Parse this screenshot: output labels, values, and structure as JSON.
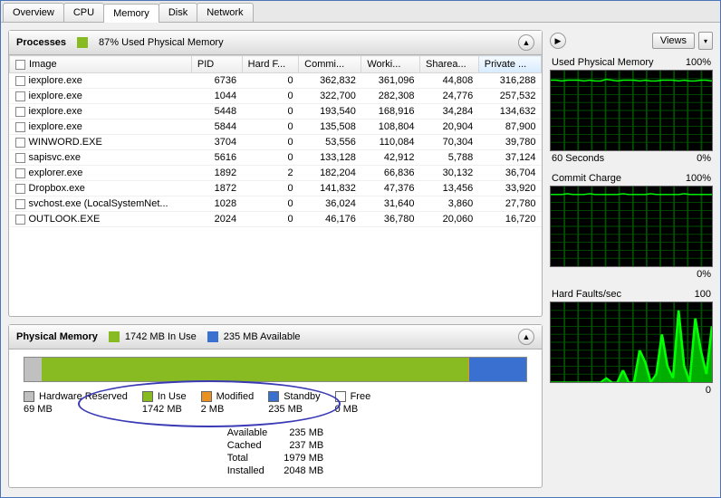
{
  "tabs": [
    "Overview",
    "CPU",
    "Memory",
    "Disk",
    "Network"
  ],
  "active_tab": "Memory",
  "processes": {
    "title": "Processes",
    "metric": "87% Used Physical Memory",
    "columns": [
      "Image",
      "PID",
      "Hard F...",
      "Commi...",
      "Worki...",
      "Sharea...",
      "Private ..."
    ],
    "sorted_col": 6,
    "rows": [
      [
        "iexplore.exe",
        "6736",
        "0",
        "362,832",
        "361,096",
        "44,808",
        "316,288"
      ],
      [
        "iexplore.exe",
        "1044",
        "0",
        "322,700",
        "282,308",
        "24,776",
        "257,532"
      ],
      [
        "iexplore.exe",
        "5448",
        "0",
        "193,540",
        "168,916",
        "34,284",
        "134,632"
      ],
      [
        "iexplore.exe",
        "5844",
        "0",
        "135,508",
        "108,804",
        "20,904",
        "87,900"
      ],
      [
        "WINWORD.EXE",
        "3704",
        "0",
        "53,556",
        "110,084",
        "70,304",
        "39,780"
      ],
      [
        "sapisvc.exe",
        "5616",
        "0",
        "133,128",
        "42,912",
        "5,788",
        "37,124"
      ],
      [
        "explorer.exe",
        "1892",
        "2",
        "182,204",
        "66,836",
        "30,132",
        "36,704"
      ],
      [
        "Dropbox.exe",
        "1872",
        "0",
        "141,832",
        "47,376",
        "13,456",
        "33,920"
      ],
      [
        "svchost.exe (LocalSystemNet...",
        "1028",
        "0",
        "36,024",
        "31,640",
        "3,860",
        "27,780"
      ],
      [
        "OUTLOOK.EXE",
        "2024",
        "0",
        "46,176",
        "36,780",
        "20,060",
        "16,720"
      ]
    ]
  },
  "physical": {
    "title": "Physical Memory",
    "in_use_label": "1742 MB In Use",
    "available_label": "235 MB Available",
    "segments": [
      {
        "label": "Hardware Reserved",
        "value": "69 MB",
        "class": "c-gray",
        "pct": 3.4
      },
      {
        "label": "In Use",
        "value": "1742 MB",
        "class": "c-green",
        "pct": 85.0
      },
      {
        "label": "Modified",
        "value": "2 MB",
        "class": "c-orange",
        "pct": 0.3
      },
      {
        "label": "Standby",
        "value": "235 MB",
        "class": "c-blue",
        "pct": 11.3
      },
      {
        "label": "Free",
        "value": "0 MB",
        "class": "c-free",
        "pct": 0
      }
    ],
    "stats": [
      [
        "Available",
        "235 MB"
      ],
      [
        "Cached",
        "237 MB"
      ],
      [
        "Total",
        "1979 MB"
      ],
      [
        "Installed",
        "2048 MB"
      ]
    ]
  },
  "right": {
    "views_label": "Views",
    "graphs": [
      {
        "title": "Used Physical Memory",
        "max": "100%",
        "xleft": "60 Seconds",
        "xright": "0%",
        "kind": "high"
      },
      {
        "title": "Commit Charge",
        "max": "100%",
        "xleft": "",
        "xright": "0%",
        "kind": "high"
      },
      {
        "title": "Hard Faults/sec",
        "max": "100",
        "xleft": "",
        "xright": "0",
        "kind": "spike"
      }
    ]
  },
  "chart_data": [
    {
      "type": "line",
      "title": "Used Physical Memory",
      "ylabel": "%",
      "ylim": [
        0,
        100
      ],
      "x_seconds": 60,
      "values": [
        88,
        88,
        87,
        88,
        88,
        88,
        87,
        88,
        87,
        87,
        89,
        88,
        87,
        88,
        88,
        88,
        87,
        88,
        87,
        87,
        88,
        88,
        88,
        87,
        88,
        87,
        87,
        88,
        88,
        87
      ]
    },
    {
      "type": "line",
      "title": "Commit Charge",
      "ylabel": "%",
      "ylim": [
        0,
        100
      ],
      "x_seconds": 60,
      "values": [
        90,
        90,
        90,
        91,
        90,
        90,
        90,
        91,
        90,
        90,
        90,
        90,
        90,
        91,
        90,
        90,
        90,
        90,
        91,
        90,
        90,
        90,
        90,
        90,
        91,
        90,
        90,
        90,
        90,
        90
      ]
    },
    {
      "type": "area",
      "title": "Hard Faults/sec",
      "ylim": [
        0,
        100
      ],
      "x_seconds": 60,
      "values": [
        0,
        0,
        0,
        0,
        0,
        0,
        0,
        0,
        0,
        0,
        5,
        0,
        0,
        15,
        0,
        0,
        40,
        25,
        0,
        10,
        60,
        20,
        5,
        90,
        20,
        0,
        80,
        40,
        10,
        70
      ]
    }
  ]
}
